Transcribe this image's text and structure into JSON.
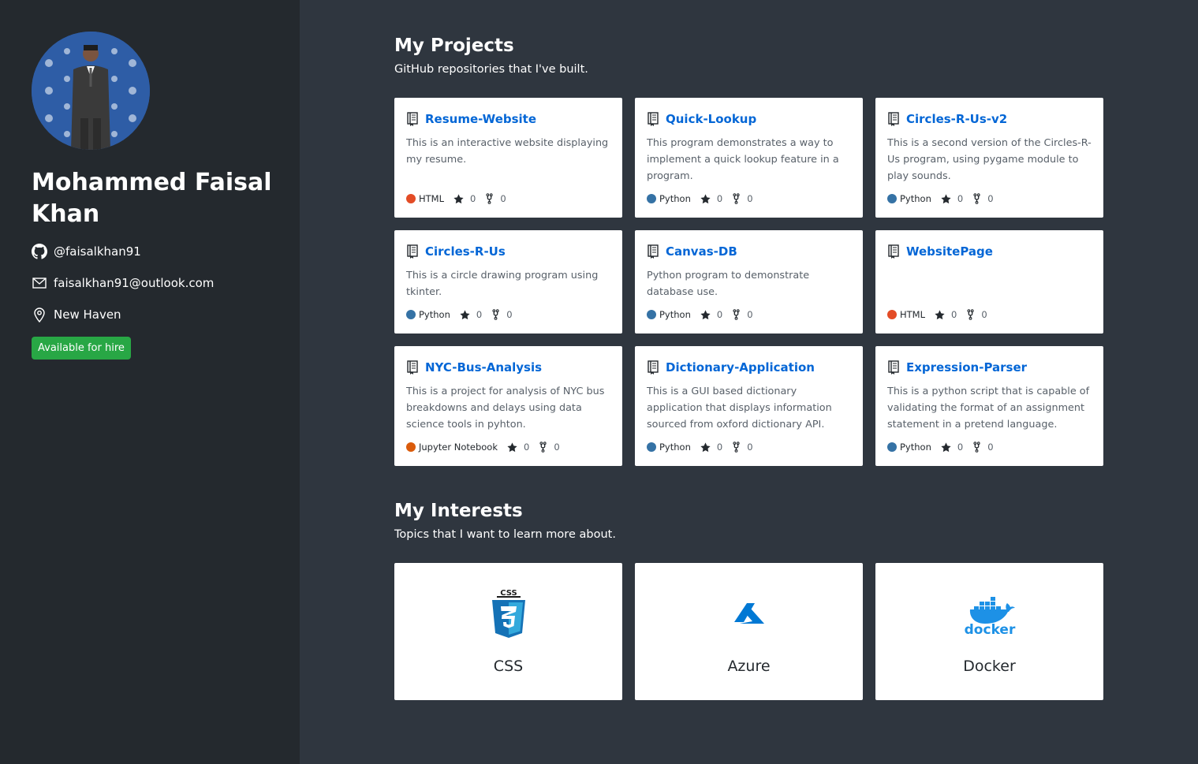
{
  "profile": {
    "name": "Mohammed Faisal Khan",
    "github": "@faisalkhan91",
    "email": "faisalkhan91@outlook.com",
    "location": "New Haven",
    "hire_badge": "Available for hire"
  },
  "projects_section": {
    "title": "My Projects",
    "subtitle": "GitHub repositories that I've built."
  },
  "projects": [
    {
      "name": "Resume-Website",
      "description": "This is an interactive website displaying my resume.",
      "language": "HTML",
      "lang_color": "#e34c26",
      "stars": "0",
      "forks": "0"
    },
    {
      "name": "Quick-Lookup",
      "description": "This program demonstrates a way to implement a quick lookup feature in a program.",
      "language": "Python",
      "lang_color": "#3572A5",
      "stars": "0",
      "forks": "0"
    },
    {
      "name": "Circles-R-Us-v2",
      "description": "This is a second version of the Circles-R-Us program, using pygame module to play sounds.",
      "language": "Python",
      "lang_color": "#3572A5",
      "stars": "0",
      "forks": "0"
    },
    {
      "name": "Circles-R-Us",
      "description": "This is a circle drawing program using tkinter.",
      "language": "Python",
      "lang_color": "#3572A5",
      "stars": "0",
      "forks": "0"
    },
    {
      "name": "Canvas-DB",
      "description": "Python program to demonstrate database use.",
      "language": "Python",
      "lang_color": "#3572A5",
      "stars": "0",
      "forks": "0"
    },
    {
      "name": "WebsitePage",
      "description": "",
      "language": "HTML",
      "lang_color": "#e34c26",
      "stars": "0",
      "forks": "0"
    },
    {
      "name": "NYC-Bus-Analysis",
      "description": "This is a project for analysis of NYC bus breakdowns and delays using data science tools in pyhton.",
      "language": "Jupyter Notebook",
      "lang_color": "#DA5B0B",
      "stars": "0",
      "forks": "0"
    },
    {
      "name": "Dictionary-Application",
      "description": "This is a GUI based dictionary application that displays information sourced from oxford dictionary API.",
      "language": "Python",
      "lang_color": "#3572A5",
      "stars": "0",
      "forks": "0"
    },
    {
      "name": "Expression-Parser",
      "description": "This is a python script that is capable of validating the format of an assignment statement in a pretend language.",
      "language": "Python",
      "lang_color": "#3572A5",
      "stars": "0",
      "forks": "0"
    }
  ],
  "interests_section": {
    "title": "My Interests",
    "subtitle": "Topics that I want to learn more about."
  },
  "interests": [
    {
      "label": "CSS",
      "icon": "css3-icon"
    },
    {
      "label": "Azure",
      "icon": "azure-icon"
    },
    {
      "label": "Docker",
      "icon": "docker-icon",
      "logo_text": "docker"
    }
  ],
  "colors": {
    "sidebar_bg": "#24292e",
    "main_bg": "#2f363f",
    "link": "#0366d6",
    "hire_green": "#28a745"
  }
}
